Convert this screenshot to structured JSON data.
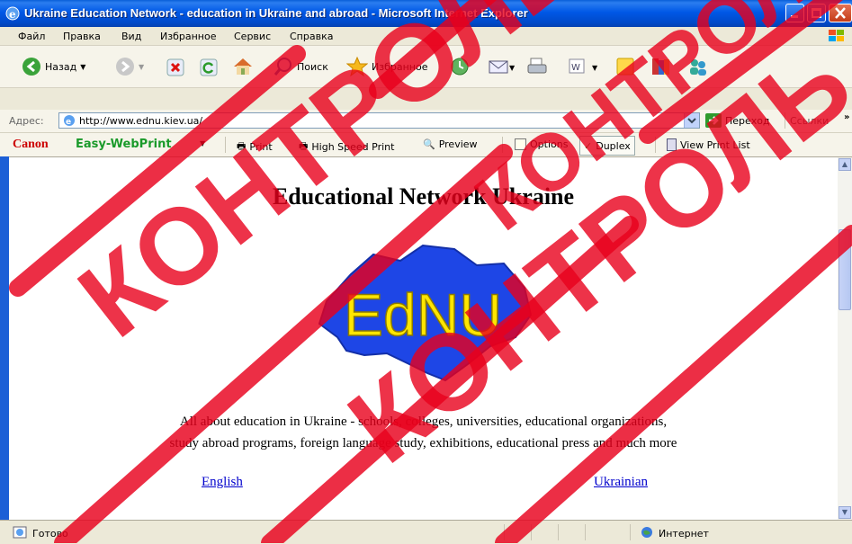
{
  "window": {
    "title": "Ukraine Education Network - education in Ukraine and abroad - Microsoft Internet Explorer"
  },
  "menu": [
    "Файл",
    "Правка",
    "Вид",
    "Избранное",
    "Сервис",
    "Справка"
  ],
  "toolbar": {
    "back": "Назад",
    "search": "Поиск",
    "favorites": "Избранное"
  },
  "address": {
    "label": "Адрес:",
    "url": "http://www.ednu.kiev.ua/",
    "go": "Переход",
    "links": "Ссылки"
  },
  "canon": {
    "brand": "Canon",
    "product": "Easy-WebPrint",
    "print": "Print",
    "hs_print": "High Speed Print",
    "preview": "Preview",
    "options": "Options",
    "duplex": "Duplex",
    "print_list": "View Print List"
  },
  "page": {
    "heading": "Educational Network Ukraine",
    "logo_text": "EdNU",
    "desc_line1": "All about education in Ukraine - schools, colleges, universities, educational organizations,",
    "desc_line2": "study abroad programs, foreign language study, exhibitions, educational press and much more",
    "link_english": "English",
    "link_ukrainian": "Ukrainian"
  },
  "status": {
    "text": "Готово",
    "zone": "Интернет"
  },
  "watermark": {
    "text": "КОНТРОЛЬ"
  },
  "colors": {
    "title_blue": "#0058e6",
    "map_blue": "#1e46e6",
    "logo_yellow": "#ffe600",
    "watermark_red": "#e8001c",
    "link": "#0000cc"
  }
}
